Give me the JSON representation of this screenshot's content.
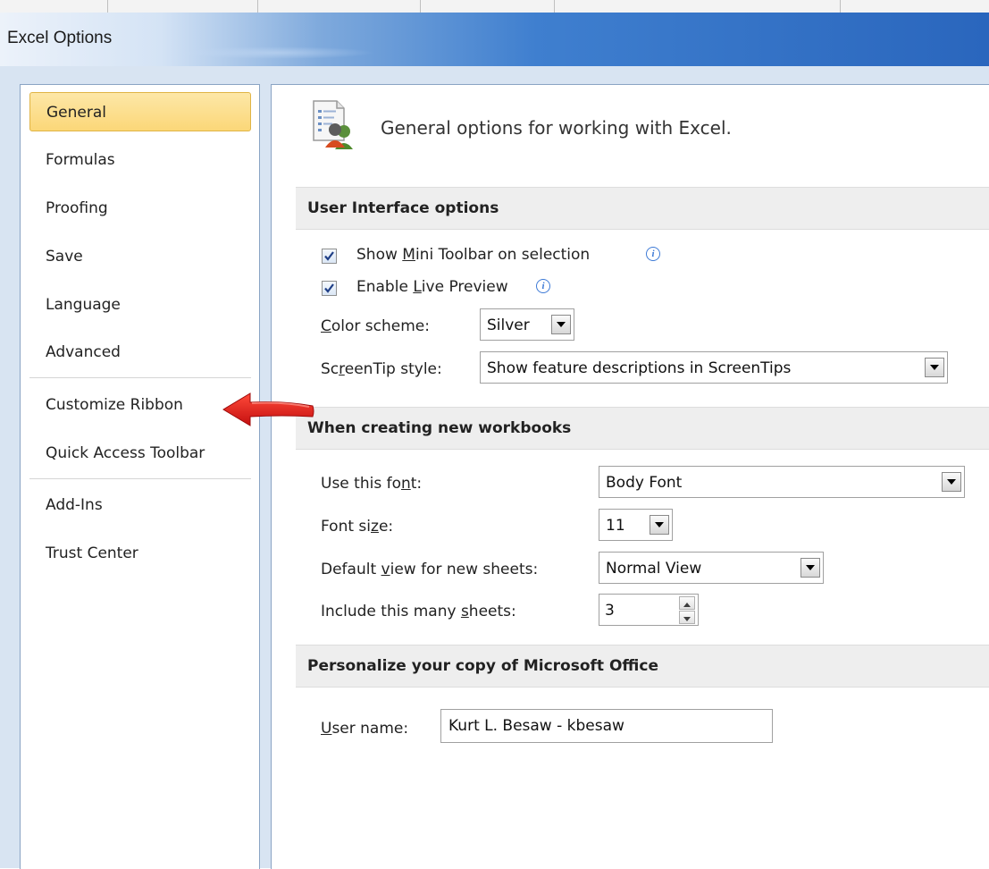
{
  "window": {
    "title": "Excel Options"
  },
  "sidebar": {
    "items": [
      {
        "label": "General",
        "selected": true
      },
      {
        "label": "Formulas"
      },
      {
        "label": "Proofing"
      },
      {
        "label": "Save"
      },
      {
        "label": "Language"
      },
      {
        "label": "Advanced"
      },
      {
        "label": "Customize Ribbon"
      },
      {
        "label": "Quick Access Toolbar"
      },
      {
        "label": "Add-Ins"
      },
      {
        "label": "Trust Center"
      }
    ]
  },
  "header": {
    "text": "General options for working with Excel.",
    "icon": "general-options-icon"
  },
  "user_interface": {
    "section_title": "User Interface options",
    "mini_toolbar": {
      "pre": "Show ",
      "u": "M",
      "post": "ini Toolbar on selection",
      "checked": true
    },
    "live_preview": {
      "pre": "Enable ",
      "u": "L",
      "post": "ive Preview",
      "checked": true
    },
    "color_scheme": {
      "u": "C",
      "post": "olor scheme:",
      "value": "Silver"
    },
    "screentip": {
      "pre": "Sc",
      "u": "r",
      "post": "eenTip style:",
      "value": "Show feature descriptions in ScreenTips"
    }
  },
  "new_workbooks": {
    "section_title": "When creating new workbooks",
    "font": {
      "pre": "Use this fo",
      "u": "n",
      "post": "t:",
      "value": "Body Font"
    },
    "font_size": {
      "pre": "Font si",
      "u": "z",
      "post": "e:",
      "value": "11"
    },
    "default_view": {
      "pre": "Default ",
      "u": "v",
      "post": "iew for new sheets:",
      "value": "Normal View"
    },
    "sheets": {
      "pre": "Include this many ",
      "u": "s",
      "post": "heets:",
      "value": "3"
    }
  },
  "personalize": {
    "section_title": "Personalize your copy of Microsoft Office",
    "user_name": {
      "u": "U",
      "post": "ser name:",
      "value": "Kurt L. Besaw - kbesaw"
    }
  },
  "annotation": {
    "arrow_color": "#e11919",
    "points_to": "Customize Ribbon"
  },
  "colors": {
    "selected_nav": "#fbd778",
    "title_bar_dark": "#2a66bd",
    "dialog_frame": "#d8e4f2"
  }
}
